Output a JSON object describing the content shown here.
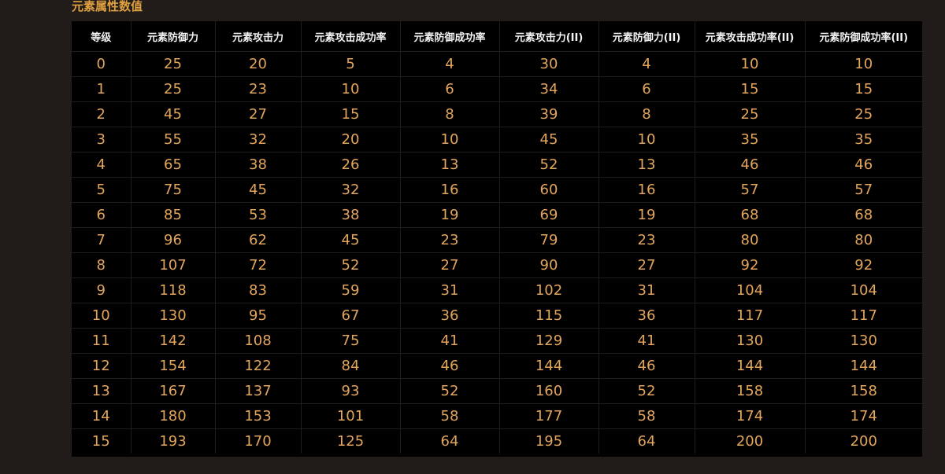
{
  "section": {
    "title": "元素属性数值"
  },
  "table": {
    "headers": [
      "等级",
      "元素防御力",
      "元素攻击力",
      "元素攻击成功率",
      "元素防御成功率",
      "元素攻击力(II)",
      "元素防御力(II)",
      "元素攻击成功率(II)",
      "元素防御成功率(II)"
    ],
    "rows": [
      [
        "0",
        "25",
        "20",
        "5",
        "4",
        "30",
        "4",
        "10",
        "10"
      ],
      [
        "1",
        "25",
        "23",
        "10",
        "6",
        "34",
        "6",
        "15",
        "15"
      ],
      [
        "2",
        "45",
        "27",
        "15",
        "8",
        "39",
        "8",
        "25",
        "25"
      ],
      [
        "3",
        "55",
        "32",
        "20",
        "10",
        "45",
        "10",
        "35",
        "35"
      ],
      [
        "4",
        "65",
        "38",
        "26",
        "13",
        "52",
        "13",
        "46",
        "46"
      ],
      [
        "5",
        "75",
        "45",
        "32",
        "16",
        "60",
        "16",
        "57",
        "57"
      ],
      [
        "6",
        "85",
        "53",
        "38",
        "19",
        "69",
        "19",
        "68",
        "68"
      ],
      [
        "7",
        "96",
        "62",
        "45",
        "23",
        "79",
        "23",
        "80",
        "80"
      ],
      [
        "8",
        "107",
        "72",
        "52",
        "27",
        "90",
        "27",
        "92",
        "92"
      ],
      [
        "9",
        "118",
        "83",
        "59",
        "31",
        "102",
        "31",
        "104",
        "104"
      ],
      [
        "10",
        "130",
        "95",
        "67",
        "36",
        "115",
        "36",
        "117",
        "117"
      ],
      [
        "11",
        "142",
        "108",
        "75",
        "41",
        "129",
        "41",
        "130",
        "130"
      ],
      [
        "12",
        "154",
        "122",
        "84",
        "46",
        "144",
        "46",
        "144",
        "144"
      ],
      [
        "13",
        "167",
        "137",
        "93",
        "52",
        "160",
        "52",
        "158",
        "158"
      ],
      [
        "14",
        "180",
        "153",
        "101",
        "58",
        "177",
        "58",
        "174",
        "174"
      ],
      [
        "15",
        "193",
        "170",
        "125",
        "64",
        "195",
        "64",
        "200",
        "200"
      ]
    ]
  },
  "colors": {
    "page_background": "#211c19",
    "table_background": "#000000",
    "title_text": "#e0a040",
    "header_text": "#f2f2f2",
    "cell_text": "#e3a55c",
    "grid_line": "#1e1e1e"
  }
}
